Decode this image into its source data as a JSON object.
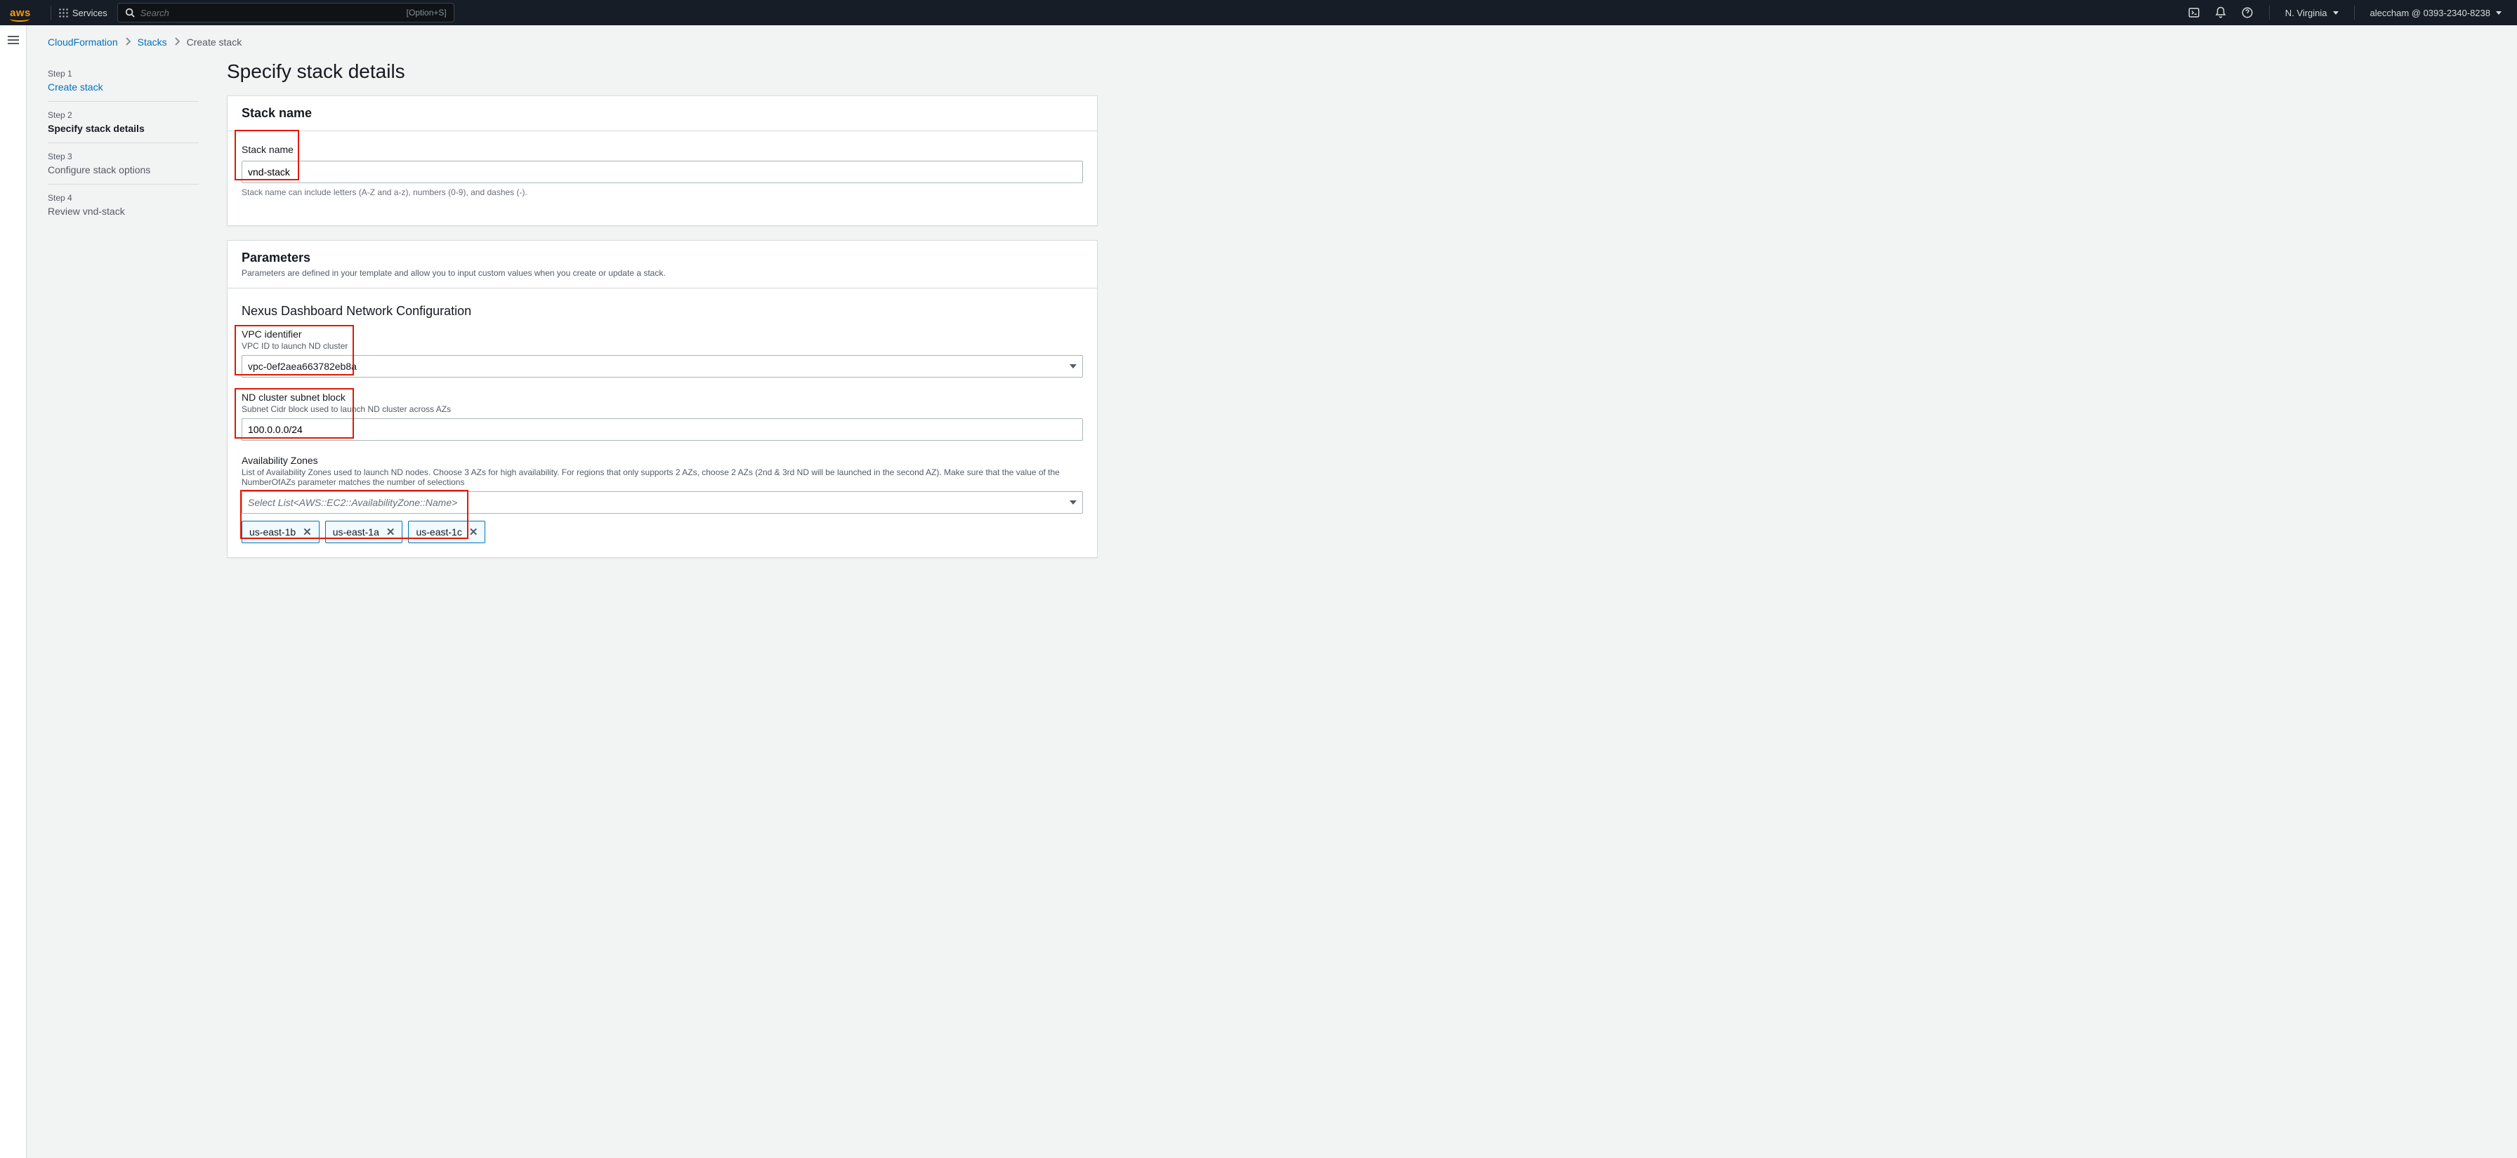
{
  "nav": {
    "services": "Services",
    "search_placeholder": "Search",
    "shortcut": "[Option+S]",
    "region": "N. Virginia",
    "account": "aleccham @ 0393-2340-8238"
  },
  "breadcrumbs": {
    "items": [
      "CloudFormation",
      "Stacks",
      "Create stack"
    ]
  },
  "wizard": {
    "steps": [
      {
        "no": "Step 1",
        "name": "Create stack",
        "state": "done"
      },
      {
        "no": "Step 2",
        "name": "Specify stack details",
        "state": "active"
      },
      {
        "no": "Step 3",
        "name": "Configure stack options",
        "state": "future"
      },
      {
        "no": "Step 4",
        "name": "Review vnd-stack",
        "state": "future"
      }
    ]
  },
  "page": {
    "title": "Specify stack details"
  },
  "stackName": {
    "panelTitle": "Stack name",
    "label": "Stack name",
    "value": "vnd-stack",
    "hint": "Stack name can include letters (A-Z and a-z), numbers (0-9), and dashes (-)."
  },
  "params": {
    "title": "Parameters",
    "desc": "Parameters are defined in your template and allow you to input custom values when you create or update a stack.",
    "section": "Nexus Dashboard Network Configuration",
    "vpc": {
      "label": "VPC identifier",
      "desc": "VPC ID to launch ND cluster",
      "value": "vpc-0ef2aea663782eb8a"
    },
    "subnet": {
      "label": "ND cluster subnet block",
      "desc": "Subnet Cidr block used to launch ND cluster across AZs",
      "value": "100.0.0.0/24"
    },
    "az": {
      "label": "Availability Zones",
      "desc": "List of Availability Zones used to launch ND nodes. Choose 3 AZs for high availability. For regions that only supports 2 AZs, choose 2 AZs (2nd & 3rd ND will be launched in the second AZ). Make sure that the value of the NumberOfAZs parameter matches the number of selections",
      "placeholder": "Select List<AWS::EC2::AvailabilityZone::Name>",
      "tokens": [
        "us-east-1b",
        "us-east-1a",
        "us-east-1c"
      ]
    }
  }
}
